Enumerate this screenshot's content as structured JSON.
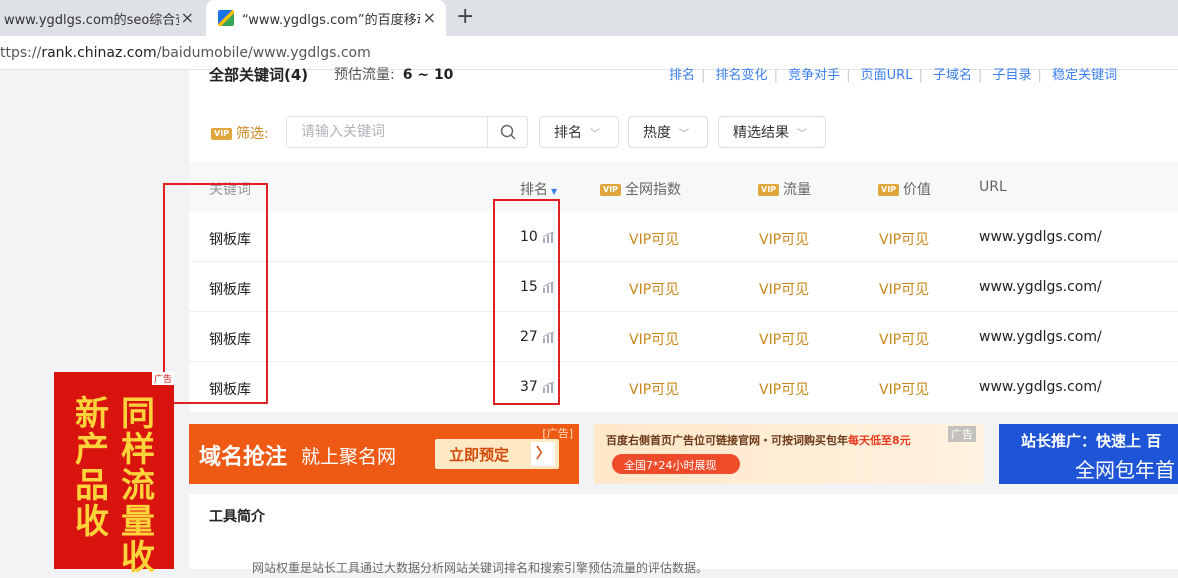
{
  "browser": {
    "tabs": [
      {
        "title": "www.ygdlgs.com的seo综合查询"
      },
      {
        "title": "“www.ygdlgs.com”的百度移动权重"
      }
    ],
    "close_glyph": "×",
    "new_tab_glyph": "+",
    "url_prefix": "ttps://",
    "url_host": "rank.chinaz.com",
    "url_path": "/baidumobile/www.ygdlgs.com"
  },
  "header": {
    "title": "全部关键词(4)",
    "flow_label": "预估流量:",
    "flow_value": "6 ~ 10",
    "links": [
      "排名",
      "排名变化",
      "竞争对手",
      "页面URL",
      "子域名",
      "子目录",
      "稳定关键词"
    ]
  },
  "filter": {
    "vip_badge": "VIP",
    "label": "筛选:",
    "search_placeholder": "请输入关键词",
    "dropdowns": [
      "排名",
      "热度",
      "精选结果"
    ]
  },
  "table": {
    "columns": {
      "keyword": "关键词",
      "rank": "排名",
      "index": "全网指数",
      "traffic": "流量",
      "value": "价值",
      "url": "URL"
    },
    "rows": [
      {
        "keyword": "钢板库",
        "rank": "10",
        "index": "VIP可见",
        "traffic": "VIP可见",
        "value": "VIP可见",
        "url": "www.ygdlgs.com/"
      },
      {
        "keyword": "钢板库",
        "rank": "15",
        "index": "VIP可见",
        "traffic": "VIP可见",
        "value": "VIP可见",
        "url": "www.ygdlgs.com/"
      },
      {
        "keyword": "钢板库",
        "rank": "27",
        "index": "VIP可见",
        "traffic": "VIP可见",
        "value": "VIP可见",
        "url": "www.ygdlgs.com/"
      },
      {
        "keyword": "钢板库",
        "rank": "37",
        "index": "VIP可见",
        "traffic": "VIP可见",
        "value": "VIP可见",
        "url": "www.ygdlgs.com/"
      }
    ]
  },
  "ads": {
    "left": {
      "tag": "广告",
      "col1": "新产品收",
      "col2": "同样流量收"
    },
    "banner1": {
      "big": "域名抢注",
      "sub": "就上聚名网",
      "cta": "立即预定",
      "tag": "[广告]"
    },
    "banner2": {
      "line1": "百度右侧首页广告位可链接官网・可按词购买包年",
      "highlight": "每天低至8元",
      "pill": "全国7*24小时展现",
      "tag": "广告"
    },
    "banner3": {
      "line1": "站长推广：快速上 百",
      "line2": "全网包年首"
    }
  },
  "intro": {
    "title": "工具简介",
    "desc": "网站权重是站长工具通过大数据分析网站关键词排名和搜索引擎预估流量的评估数据。"
  },
  "colors": {
    "accent": "#3c7ff0",
    "vip": "#c8881c",
    "highlight_box": "#e02020"
  }
}
